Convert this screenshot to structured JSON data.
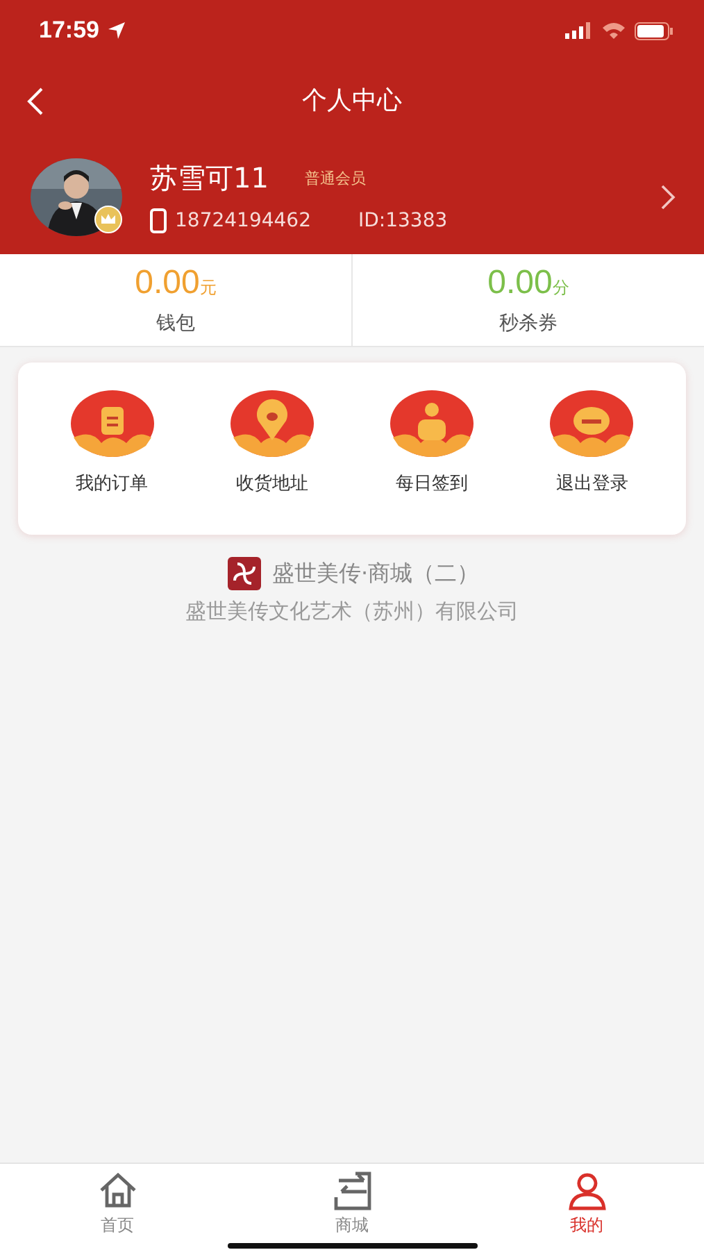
{
  "status_bar": {
    "time": "17:59"
  },
  "nav": {
    "title": "个人中心"
  },
  "profile": {
    "name": "苏雪可11",
    "level": "普通会员",
    "phone": "18724194462",
    "id": "ID:13383"
  },
  "stats": [
    {
      "value": "0.00",
      "unit": "元",
      "label": "钱包",
      "color": "#f0a030"
    },
    {
      "value": "0.00",
      "unit": "分",
      "label": "秒杀券",
      "color": "#7cbf4a"
    }
  ],
  "menu": [
    {
      "kind": "order",
      "label": "我的订单"
    },
    {
      "kind": "address",
      "label": "收货地址"
    },
    {
      "kind": "checkin",
      "label": "每日签到"
    },
    {
      "kind": "logout",
      "label": "退出登录"
    }
  ],
  "footer": {
    "brand": "盛世美传·商城（二）",
    "company": "盛世美传文化艺术（苏州）有限公司"
  },
  "tabs": [
    {
      "kind": "home",
      "label": "首页",
      "selected": false
    },
    {
      "kind": "mall",
      "label": "商城",
      "selected": false
    },
    {
      "kind": "me",
      "label": "我的",
      "selected": true
    }
  ]
}
